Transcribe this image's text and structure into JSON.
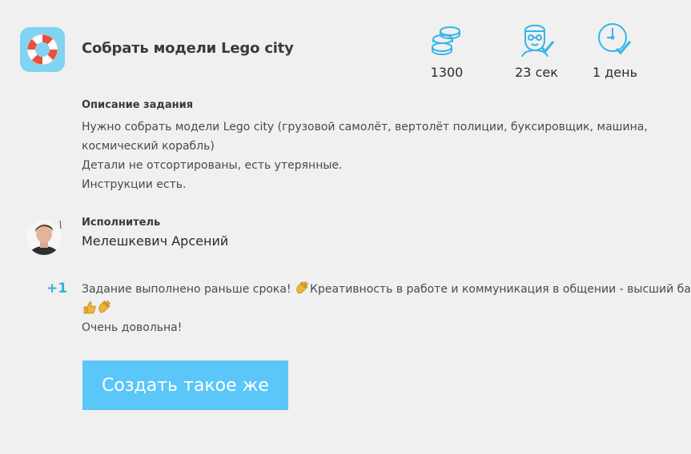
{
  "task": {
    "title": "Собрать модели Lego city",
    "icon": "lifebuoy-icon",
    "accent_color": "#7fd3f3"
  },
  "stats": {
    "coins": {
      "icon": "coins-icon",
      "value": "1300"
    },
    "time": {
      "icon": "person-check-icon",
      "value": "23 сек"
    },
    "deadline": {
      "icon": "clock-check-icon",
      "value": "1 день"
    }
  },
  "description": {
    "title": "Описание задания",
    "lines": [
      "Нужно собрать модели Lego city (грузовой самолёт, вертолёт полиции, буксировщик, машина,",
      "космический корабль)",
      "Детали не отсортированы, есть утерянные.",
      "Инструкции есть."
    ]
  },
  "executor": {
    "label": "Исполнитель",
    "name": "Мелешкевич Арсений",
    "avatar": "avatar"
  },
  "review": {
    "score": "+1",
    "score_color": "#3aaee0",
    "line1_a": "Задание выполнено раньше срока! ",
    "line1_b": "Креативность в работе и коммуникация в общении - высший балл",
    "line3": "Очень довольна!",
    "emojis": [
      "clapping-hands-icon",
      "thumbs-up-icon",
      "clapping-hands-icon"
    ]
  },
  "cta": {
    "label": "Создать такое же",
    "color": "#5bc6f8"
  }
}
